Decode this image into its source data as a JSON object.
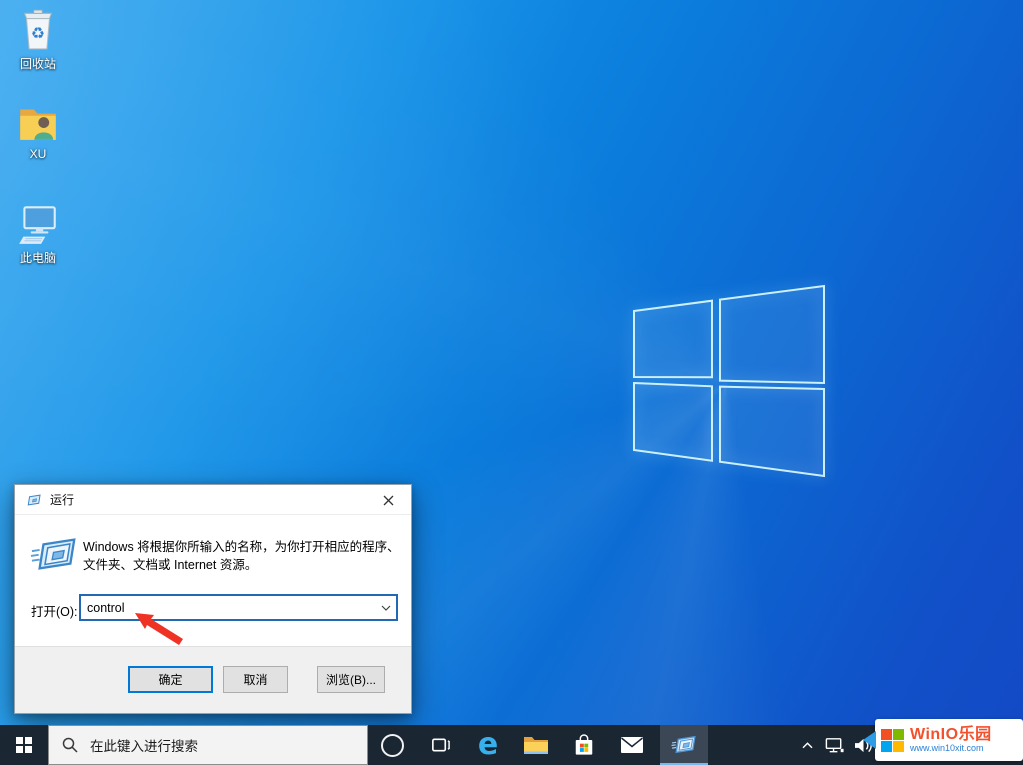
{
  "desktop": {
    "icons": [
      {
        "name": "recycle-bin",
        "label": "回收站"
      },
      {
        "name": "user-folder",
        "label": "XU"
      },
      {
        "name": "this-pc",
        "label": "此电脑"
      }
    ]
  },
  "run_dialog": {
    "title": "运行",
    "description_line1": "Windows 将根据你所输入的名称，为你打开相应的程序、",
    "description_line2": "文件夹、文档或 Internet 资源。",
    "open_label": "打开(O):",
    "input_value": "control",
    "buttons": {
      "ok": "确定",
      "cancel": "取消",
      "browse": "浏览(B)..."
    }
  },
  "taskbar": {
    "search_placeholder": "在此键入进行搜索",
    "icons": [
      "start",
      "search",
      "cortana",
      "task-view",
      "edge",
      "file-explorer",
      "store",
      "mail",
      "run"
    ],
    "tray_icons": [
      "tray-expand",
      "network",
      "volume"
    ]
  },
  "watermark": {
    "title": "WinIO乐园",
    "url": "www.win10xit.com"
  },
  "annotation": {
    "type": "red-arrow",
    "points_to": "run-command-input"
  },
  "colors": {
    "accent": "#0078d7",
    "taskbar_bg": "#1b2633",
    "arrow_red": "#ee3324",
    "watermark_title": "#f3502c",
    "watermark_url": "#2b80d6",
    "active_task_underline": "#76b9ed"
  }
}
